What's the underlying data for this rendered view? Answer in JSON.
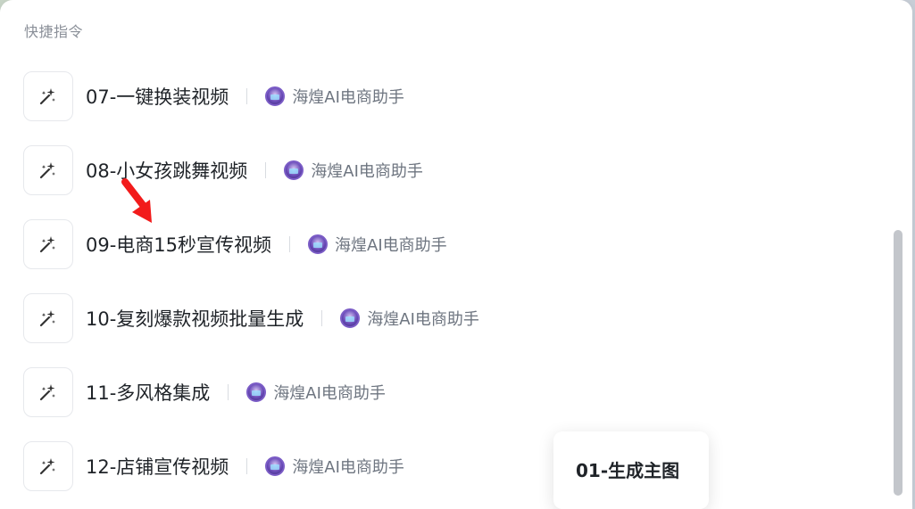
{
  "section_title": "快捷指令",
  "items": [
    {
      "name": "07-一键换装视频",
      "author": "海煌AI电商助手"
    },
    {
      "name": "08-小女孩跳舞视频",
      "author": "海煌AI电商助手"
    },
    {
      "name": "09-电商15秒宣传视频",
      "author": "海煌AI电商助手"
    },
    {
      "name": "10-复刻爆款视频批量生成",
      "author": "海煌AI电商助手"
    },
    {
      "name": "11-多风格集成",
      "author": "海煌AI电商助手"
    },
    {
      "name": "12-店铺宣传视频",
      "author": "海煌AI电商助手"
    }
  ],
  "tooltip": {
    "label": "01-生成主图"
  },
  "icons": {
    "item_icon": "sparkle-wand-icon",
    "pointer": "red-arrow-icon"
  },
  "colors": {
    "accent_arrow": "#f21b1b",
    "avatar_border": "#7b5cc6"
  }
}
